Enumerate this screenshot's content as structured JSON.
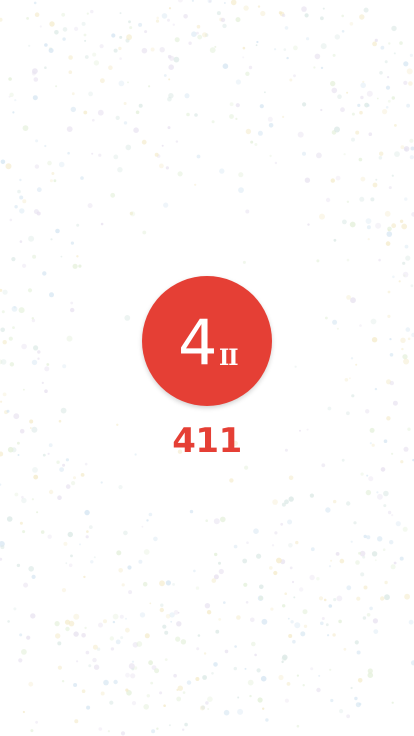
{
  "app": {
    "name": "411",
    "logo_icon": "app-logo-icon",
    "logo_digit": "4",
    "logo_suffix": "II"
  },
  "colors": {
    "brand_red": "#E53F35",
    "logo_text": "#FFFFFF",
    "background": "#FFFFFF",
    "dot_palette": [
      "#D6E6F2",
      "#E4F0DA",
      "#F4EBCB",
      "#E8E2F0",
      "#DCE9E6"
    ]
  }
}
